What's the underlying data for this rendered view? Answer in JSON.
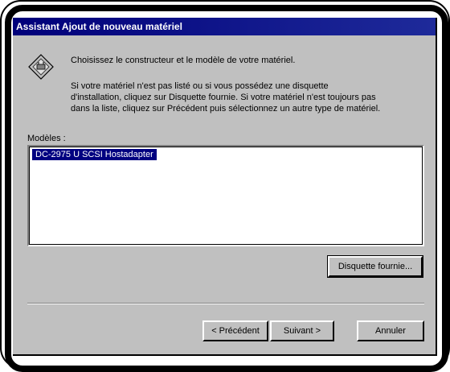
{
  "window": {
    "title": "Assistant Ajout de nouveau matériel"
  },
  "content": {
    "instruction": "Choisissez le constructeur et le modèle de votre matériel.",
    "help_line1": "Si votre matériel n'est pas listé ou si vous possédez une disquette",
    "help_line2": "d'installation, cliquez sur Disquette fournie. Si votre matériel n'est toujours pas",
    "help_line3": "dans la liste, cliquez sur Précédent puis sélectionnez un autre type de matériel.",
    "icon": "hardware-wizard-icon"
  },
  "models": {
    "label": "Modèles :",
    "items": [
      "DC-2975 U SCSI Hostadapter"
    ],
    "selected_index": 0
  },
  "buttons": {
    "have_disk": "Disquette fournie...",
    "back": "< Précédent",
    "next": "Suivant >",
    "cancel": "Annuler"
  },
  "colors": {
    "titlebar": "#00007a",
    "dialog_bg": "#c0c0c0",
    "selection": "#000080"
  }
}
